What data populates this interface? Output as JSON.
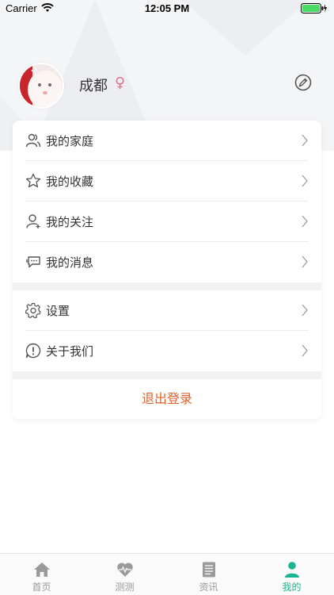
{
  "status_bar": {
    "carrier": "Carrier",
    "time": "12:05 PM"
  },
  "profile": {
    "name": "成都",
    "gender_symbol": "♀"
  },
  "menu": {
    "group1": [
      {
        "label": "我的家庭",
        "icon": "family-icon"
      },
      {
        "label": "我的收藏",
        "icon": "star-icon"
      },
      {
        "label": "我的关注",
        "icon": "follow-icon"
      },
      {
        "label": "我的消息",
        "icon": "message-icon"
      }
    ],
    "group2": [
      {
        "label": "设置",
        "icon": "gear-icon"
      },
      {
        "label": "关于我们",
        "icon": "info-icon"
      }
    ],
    "logout_label": "退出登录"
  },
  "tabbar": {
    "tabs": [
      {
        "label": "首页",
        "icon": "home-icon"
      },
      {
        "label": "测测",
        "icon": "heart-pulse-icon"
      },
      {
        "label": "资讯",
        "icon": "news-icon"
      },
      {
        "label": "我的",
        "icon": "person-icon"
      }
    ],
    "active_index": 3
  },
  "colors": {
    "accent": "#1cb394",
    "logout": "#e0612b",
    "gender": "#e46f8e"
  }
}
